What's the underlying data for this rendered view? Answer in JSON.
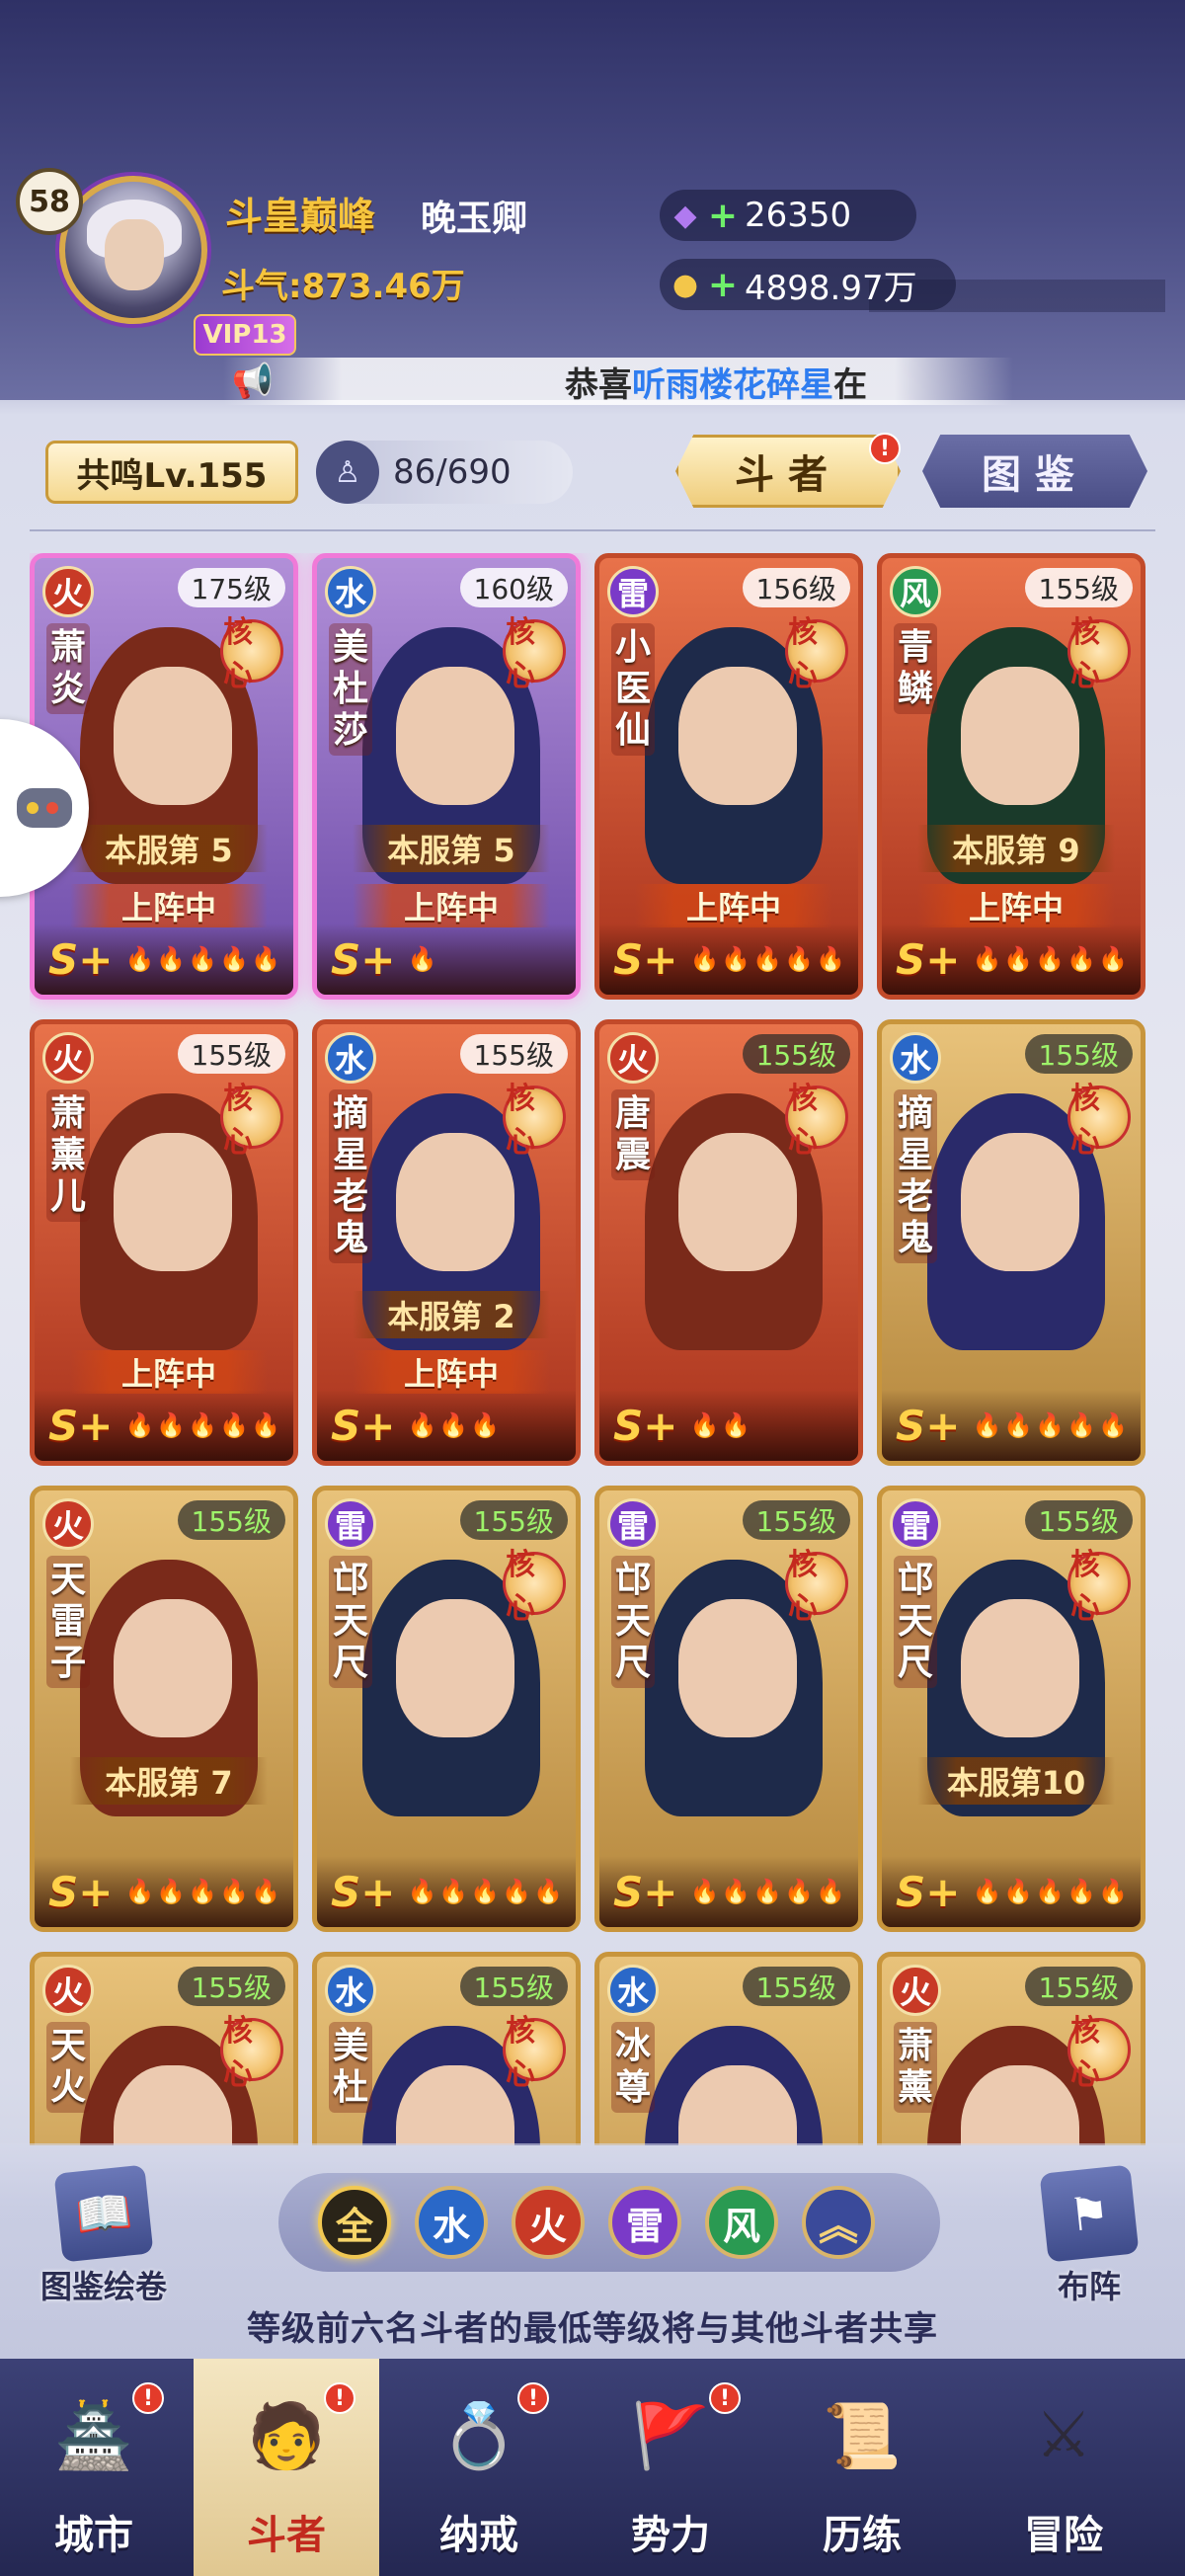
{
  "header": {
    "player_level": "58",
    "title": "斗皇巅峰",
    "player_name": "晚玉卿",
    "power": "斗气:873.46万",
    "vip": "VIP13",
    "currency_gem": "26350",
    "currency_gold": "4898.97万",
    "marquee_prefix": "恭喜",
    "marquee_highlight": "听雨楼花碎星",
    "marquee_suffix": "在"
  },
  "toolbar": {
    "resonance": "共鸣Lv.155",
    "hero_count": "86/690",
    "tab_fighters": "斗者",
    "tab_album": "图鉴",
    "badge": "!"
  },
  "cards": [
    {
      "element": "火",
      "level": "175级",
      "name": "萧炎",
      "rank": "本服第 5",
      "deployed": "上阵中",
      "grade": "S+",
      "stars": "🔥🔥🔥🔥🔥",
      "core": "核心"
    },
    {
      "element": "水",
      "level": "160级",
      "name": "美杜莎",
      "rank": "本服第 5",
      "deployed": "上阵中",
      "grade": "S+",
      "stars": "🔥",
      "core": "核心"
    },
    {
      "element": "雷",
      "level": "156级",
      "name": "小医仙",
      "rank": "",
      "deployed": "上阵中",
      "grade": "S+",
      "stars": "🔥🔥🔥🔥🔥",
      "core": "核心"
    },
    {
      "element": "风",
      "level": "155级",
      "name": "青鳞",
      "rank": "本服第 9",
      "deployed": "上阵中",
      "grade": "S+",
      "stars": "🔥🔥🔥🔥🔥",
      "core": "核心"
    },
    {
      "element": "火",
      "level": "155级",
      "name": "萧薰儿",
      "rank": "",
      "deployed": "上阵中",
      "grade": "S+",
      "stars": "🔥🔥🔥🔥🔥",
      "core": "核心"
    },
    {
      "element": "水",
      "level": "155级",
      "name": "摘星老鬼",
      "rank": "本服第 2",
      "deployed": "上阵中",
      "grade": "S+",
      "stars": "🔥🔥🔥",
      "core": "核心"
    },
    {
      "element": "火",
      "level": "155级",
      "name": "唐震",
      "rank": "",
      "deployed": "",
      "grade": "S+",
      "stars": "🔥🔥",
      "core": "核心"
    },
    {
      "element": "水",
      "level": "155级",
      "name": "摘星老鬼",
      "rank": "",
      "deployed": "",
      "grade": "S+",
      "stars": "🔥🔥🔥🔥🔥",
      "core": "核心"
    },
    {
      "element": "火",
      "level": "155级",
      "name": "天雷子",
      "rank": "本服第 7",
      "deployed": "",
      "grade": "S+",
      "stars": "🔥🔥🔥🔥🔥",
      "core": ""
    },
    {
      "element": "雷",
      "level": "155级",
      "name": "邙天尺",
      "rank": "",
      "deployed": "",
      "grade": "S+",
      "stars": "🔥🔥🔥🔥🔥",
      "core": "核心"
    },
    {
      "element": "雷",
      "level": "155级",
      "name": "邙天尺",
      "rank": "",
      "deployed": "",
      "grade": "S+",
      "stars": "🔥🔥🔥🔥🔥",
      "core": "核心"
    },
    {
      "element": "雷",
      "level": "155级",
      "name": "邙天尺",
      "rank": "本服第10",
      "deployed": "",
      "grade": "S+",
      "stars": "🔥🔥🔥🔥🔥",
      "core": "核心"
    },
    {
      "element": "火",
      "level": "155级",
      "name": "天火",
      "rank": "",
      "deployed": "",
      "grade": "",
      "stars": "",
      "core": "核心"
    },
    {
      "element": "水",
      "level": "155级",
      "name": "美杜",
      "rank": "",
      "deployed": "",
      "grade": "",
      "stars": "",
      "core": "核心"
    },
    {
      "element": "水",
      "level": "155级",
      "name": "冰尊",
      "rank": "",
      "deployed": "",
      "grade": "",
      "stars": "",
      "core": ""
    },
    {
      "element": "火",
      "level": "155级",
      "name": "萧薰",
      "rank": "",
      "deployed": "",
      "grade": "",
      "stars": "",
      "core": "核心"
    }
  ],
  "filters": {
    "album": "图鉴绘卷",
    "formation": "布阵",
    "all": "全",
    "water": "水",
    "fire": "火",
    "thunder": "雷",
    "wind": "风",
    "collapse": "︽",
    "notice": "等级前六名斗者的最低等级将与其他斗者共享"
  },
  "nav": {
    "city": "城市",
    "fighters": "斗者",
    "ring": "纳戒",
    "faction": "势力",
    "training": "历练",
    "adventure": "冒险"
  },
  "colors": {
    "accent_gold": "#f6c53d",
    "fire": "#c83a26",
    "water": "#2a68c8",
    "thunder": "#7a3ac8",
    "wind": "#2a9a52"
  }
}
